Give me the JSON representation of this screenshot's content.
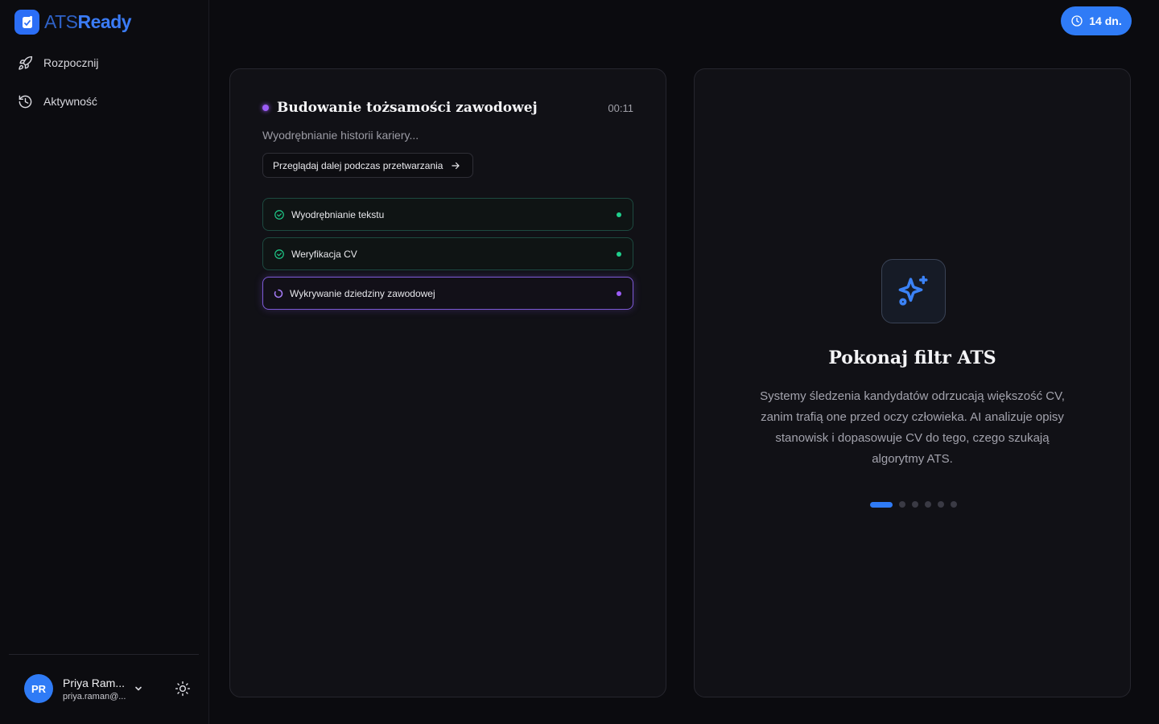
{
  "brand": {
    "name_part1": "ATS",
    "name_part2": "Ready"
  },
  "nav": {
    "items": [
      {
        "label": "Rozpocznij",
        "icon": "rocket-icon"
      },
      {
        "label": "Aktywność",
        "icon": "history-icon"
      }
    ]
  },
  "user": {
    "initials": "PR",
    "name": "Priya Ram...",
    "email": "priya.raman@..."
  },
  "trial": {
    "label": "14 dn."
  },
  "processing": {
    "title": "Budowanie tożsamości zawodowej",
    "timer": "00:11",
    "subtitle": "Wyodrębnianie historii kariery...",
    "browse_label": "Przeglądaj dalej podczas przetwarzania",
    "steps": [
      {
        "label": "Wyodrębnianie tekstu",
        "status": "done"
      },
      {
        "label": "Weryfikacja CV",
        "status": "done"
      },
      {
        "label": "Wykrywanie dziedziny zawodowej",
        "status": "in-progress"
      }
    ]
  },
  "feature": {
    "title": "Pokonaj filtr ATS",
    "description": "Systemy śledzenia kandydatów odrzucają większość CV, zanim trafią one przed oczy człowieka. AI analizuje opisy stanowisk i dopasowuje CV do tego, czego szukają algorytmy ATS.",
    "pager_count": 6,
    "pager_active": 1
  },
  "colors": {
    "accent": "#2f7bf6",
    "success": "#1fcf8c",
    "progress": "#9b5cf6",
    "background": "#0b0b0f"
  }
}
